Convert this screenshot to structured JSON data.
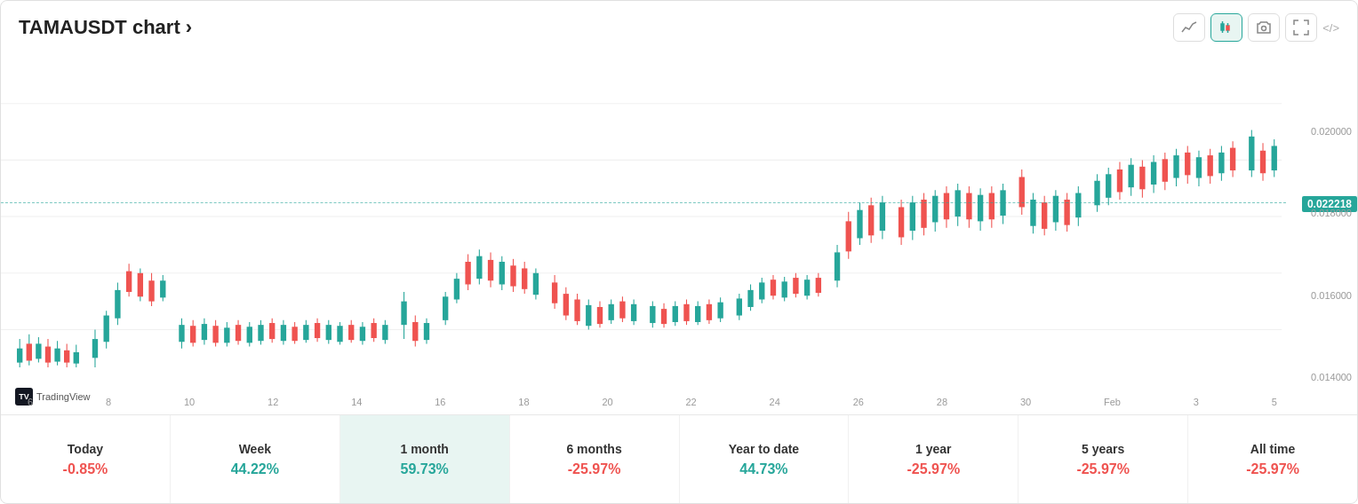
{
  "header": {
    "title": "TAMAUSDT chart ›",
    "controls": [
      {
        "name": "line-chart",
        "icon": "∿",
        "active": false
      },
      {
        "name": "candle-chart",
        "icon": "⧉",
        "active": true
      },
      {
        "name": "camera",
        "icon": "📷",
        "active": false
      },
      {
        "name": "fullscreen",
        "icon": "⛶",
        "active": false
      }
    ],
    "embed_icon": "</>"
  },
  "chart": {
    "current_price": "0.022218",
    "dashed_line_visible": true,
    "tradingview_label": "TradingView",
    "x_axis_labels": [
      "6",
      "8",
      "10",
      "12",
      "14",
      "16",
      "18",
      "20",
      "22",
      "24",
      "26",
      "28",
      "30",
      "Feb",
      "3",
      "5"
    ],
    "y_axis_labels": [
      "0.022218",
      "0.020000",
      "0.018000",
      "0.016000",
      "0.014000"
    ]
  },
  "footer": {
    "items": [
      {
        "label": "Today",
        "value": "-0.85%",
        "positive": false,
        "active": false
      },
      {
        "label": "Week",
        "value": "44.22%",
        "positive": true,
        "active": false
      },
      {
        "label": "1 month",
        "value": "59.73%",
        "positive": true,
        "active": true
      },
      {
        "label": "6 months",
        "value": "-25.97%",
        "positive": false,
        "active": false
      },
      {
        "label": "Year to date",
        "value": "44.73%",
        "positive": true,
        "active": false
      },
      {
        "label": "1 year",
        "value": "-25.97%",
        "positive": false,
        "active": false
      },
      {
        "label": "5 years",
        "value": "-25.97%",
        "positive": false,
        "active": false
      },
      {
        "label": "All time",
        "value": "-25.97%",
        "positive": false,
        "active": false
      }
    ]
  }
}
